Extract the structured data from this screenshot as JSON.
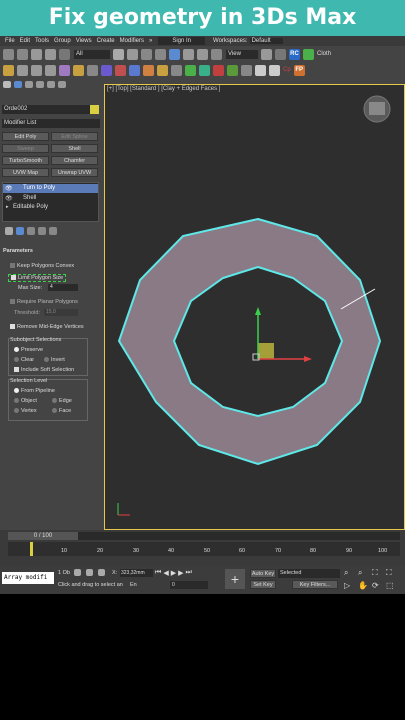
{
  "banner": "Fix geometry in 3Ds Max",
  "menu": [
    "File",
    "Edit",
    "Tools",
    "Group",
    "Views",
    "Create",
    "Modifiers",
    "»"
  ],
  "signin": "Sign In",
  "workspaces_label": "Workspaces:",
  "workspaces_value": "Default",
  "selection_filter": "All",
  "view_dropdown": "View",
  "rc_badge": "RC",
  "cloth_label": "Cloth",
  "fp_badge": "FP",
  "cp_badge": "Cp",
  "object_name": "Orde002",
  "modifier_list": "Modifier List",
  "modifier_buttons": [
    "Edit Poly",
    "Edit Spline",
    "Sweep",
    "Shell",
    "TurboSmooth",
    "Chamfer",
    "UVW Map",
    "Unwrap UVW"
  ],
  "stack": [
    "Turn to Poly",
    "Shell",
    "Editable Poly"
  ],
  "rollout_title": "Parameters",
  "keep_convex": "Keep Polygons Convex",
  "limit_size": "Limit Polygon Size",
  "max_size_label": "Max Size:",
  "max_size_value": "4",
  "require_planar": "Require Planar Polygons",
  "threshold_label": "Threshold:",
  "threshold_value": "15,0",
  "remove_mid": "Remove Mid-Edge Vertices",
  "subobject_title": "Subobject Selections",
  "preserve": "Preserve",
  "clear": "Clear",
  "invert": "Invert",
  "include_soft": "Include Soft Selection",
  "selection_level_title": "Selection Level",
  "from_pipeline": "From Pipeline",
  "lvl_object": "Object",
  "lvl_edge": "Edge",
  "lvl_vertex": "Vertex",
  "lvl_face": "Face",
  "viewport_label": "[+] [Top] [Standard ] [Clay + Edged Faces ]",
  "time_slider": "0 / 100",
  "ruler_ticks": [
    "10",
    "20",
    "30",
    "40",
    "50",
    "60",
    "70",
    "80",
    "90",
    "100"
  ],
  "script_box": "Array modifi",
  "obj_count": "1 Ob",
  "x_label": "X:",
  "x_value": "323,32mm",
  "prompt": "Click and drag to select an",
  "en_label": "En",
  "autokey": "Auto Key",
  "selected": "Selected",
  "setkey": "Set Key",
  "keyfilters": "Key Filters...",
  "frame": "0",
  "colors": {
    "banner": "#3fb8b0",
    "ring": "#8a7a86",
    "ring_edge": "#5fe8e8",
    "active": "#e8c84a",
    "highlight": "#3ad04a",
    "selected": "#5a7ab8"
  }
}
